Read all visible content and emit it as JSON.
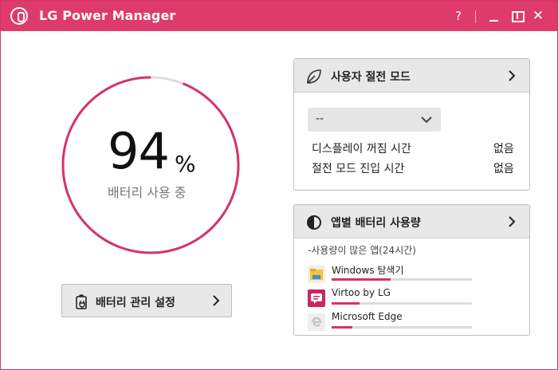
{
  "app": {
    "title": "LG Power Manager",
    "accent_color": "#de3b6c",
    "titlebar_icons": [
      "help-icon",
      "minimize-icon",
      "restore-icon",
      "close-icon"
    ],
    "help_glyph": "?",
    "close_glyph": "✕"
  },
  "battery": {
    "percent_value": 94,
    "percent_text": "94",
    "percent_sign": "%",
    "status_label": "배터리 사용 중",
    "ring_fill_fraction": 0.94,
    "ring_color": "#d6336a",
    "ring_track_color": "#dddddd"
  },
  "battery_settings_button": {
    "label": "배터리 관리 설정",
    "icon": "battery-plug-icon"
  },
  "power_saving_panel": {
    "title": "사용자 절전 모드",
    "icon": "leaf-icon",
    "select_value": "--",
    "rows": [
      {
        "label": "디스플레이 꺼짐 시간",
        "value": "없음"
      },
      {
        "label": "절전 모드 진입 시간",
        "value": "없음"
      }
    ]
  },
  "app_usage_panel": {
    "title": "앱별 배터리 사용량",
    "icon": "half-circle-icon",
    "caption": "-사용량이 많은 앱(24시간)",
    "apps": [
      {
        "name": "Windows 탐색기",
        "icon": "file-explorer-icon",
        "usage_fraction": 0.42
      },
      {
        "name": "Virtoo by LG",
        "icon": "virtoo-icon",
        "usage_fraction": 0.2
      },
      {
        "name": "Microsoft Edge",
        "icon": "edge-icon",
        "usage_fraction": 0.15
      }
    ]
  }
}
